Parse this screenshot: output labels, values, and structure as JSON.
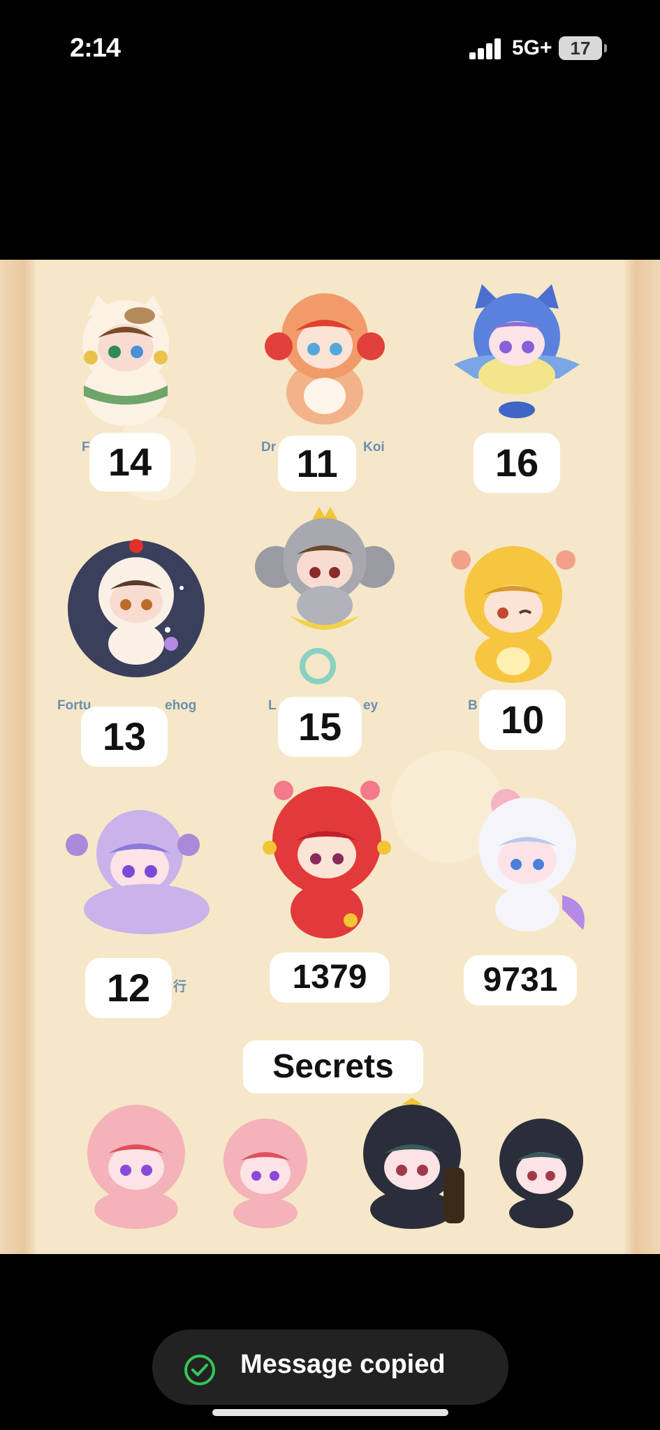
{
  "status_bar": {
    "time": "2:14",
    "network": "5G+",
    "battery": "17"
  },
  "poster": {
    "figures": [
      {
        "number": "14",
        "caption": "Fo"
      },
      {
        "number": "11",
        "caption": "Dr"
      },
      {
        "number": "16",
        "caption": ""
      },
      {
        "number": "13",
        "caption": "Fortu"
      },
      {
        "number": "15",
        "caption": "L"
      },
      {
        "number": "10",
        "caption": "B"
      },
      {
        "number": "12",
        "caption": ""
      },
      {
        "number": "1379",
        "caption": ""
      },
      {
        "number": "9731",
        "caption": ""
      }
    ],
    "captions_extra": [
      "Koi",
      "ehog",
      "ey",
      "r",
      "行"
    ],
    "secrets_label": "Secrets"
  },
  "toast": {
    "icon": "check-circle-icon",
    "text": "Message copied"
  },
  "colors": {
    "poster_bg": "#f6e7c9",
    "toast_bg": "#222222",
    "check_green": "#34c759"
  }
}
